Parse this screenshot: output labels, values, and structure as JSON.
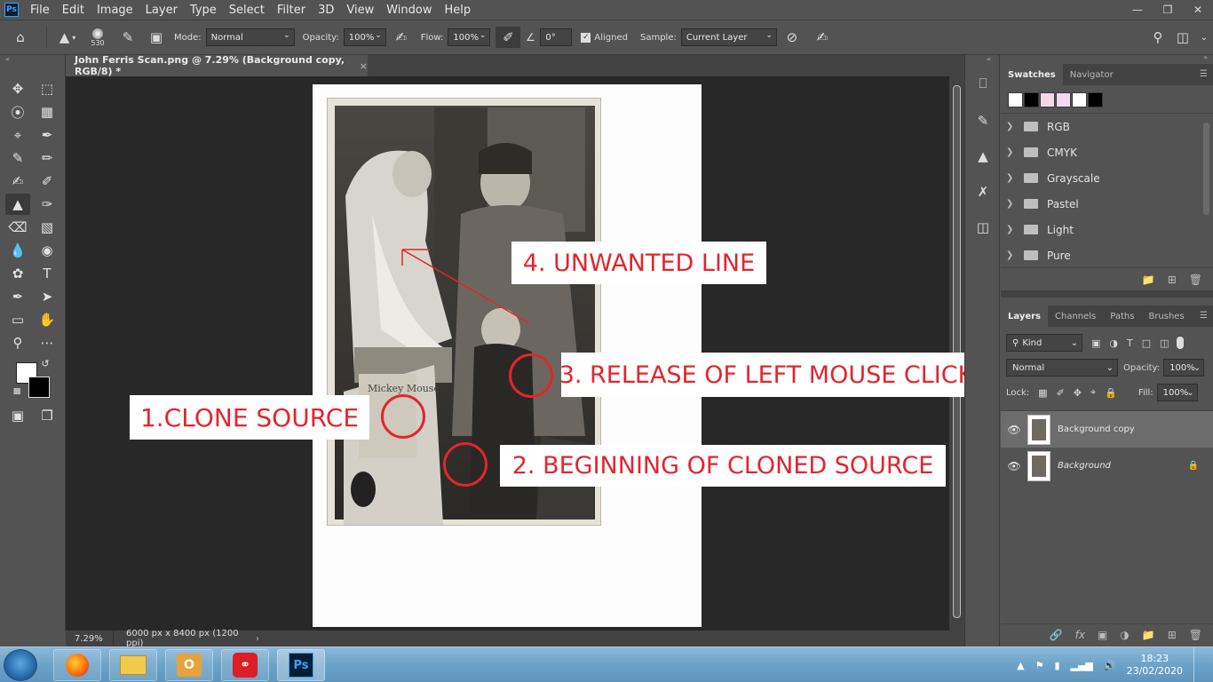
{
  "menubar": {
    "logo": "Ps",
    "items": [
      "File",
      "Edit",
      "Image",
      "Layer",
      "Type",
      "Select",
      "Filter",
      "3D",
      "View",
      "Window",
      "Help"
    ]
  },
  "options": {
    "brush_size": "530",
    "mode_label": "Mode:",
    "mode_value": "Normal",
    "opacity_label": "Opacity:",
    "opacity_value": "100%",
    "flow_label": "Flow:",
    "flow_value": "100%",
    "angle_value": "0°",
    "aligned_label": "Aligned",
    "sample_label": "Sample:",
    "sample_value": "Current Layer"
  },
  "document": {
    "tab_title": "John Ferris Scan.png @ 7.29% (Background copy, RGB/8) *",
    "zoom": "7.29%",
    "dimensions": "6000 px x 8400 px (1200 ppi)"
  },
  "annotations": {
    "a1": "1.CLONE SOURCE",
    "a2": "2. BEGINNING OF CLONED SOURCE",
    "a3": "3. RELEASE OF LEFT MOUSE CLICK",
    "a4": "4. UNWANTED LINE",
    "color": "#e1262d"
  },
  "swatches_panel": {
    "tabs": [
      "Swatches",
      "Navigator"
    ],
    "colors": [
      "#ffffff",
      "#000000",
      "#f5d7ea",
      "#f2d9ee",
      "#ffffff",
      "#000000"
    ],
    "groups": [
      "RGB",
      "CMYK",
      "Grayscale",
      "Pastel",
      "Light",
      "Pure"
    ]
  },
  "layers_panel": {
    "tabs": [
      "Layers",
      "Channels",
      "Paths",
      "Brushes"
    ],
    "kind_label": "Kind",
    "blend_mode": "Normal",
    "opacity_label": "Opacity:",
    "opacity_value": "100%",
    "lock_label": "Lock:",
    "fill_label": "Fill:",
    "fill_value": "100%",
    "layers": [
      {
        "name": "Background copy",
        "selected": true
      },
      {
        "name": "Background",
        "selected": false,
        "locked": true
      }
    ]
  },
  "taskbar": {
    "time": "18:23",
    "date": "23/02/2020",
    "apps": [
      "firefox-icon",
      "file-explorer-icon",
      "outlook-icon",
      "creative-cloud-icon",
      "photoshop-icon"
    ]
  }
}
